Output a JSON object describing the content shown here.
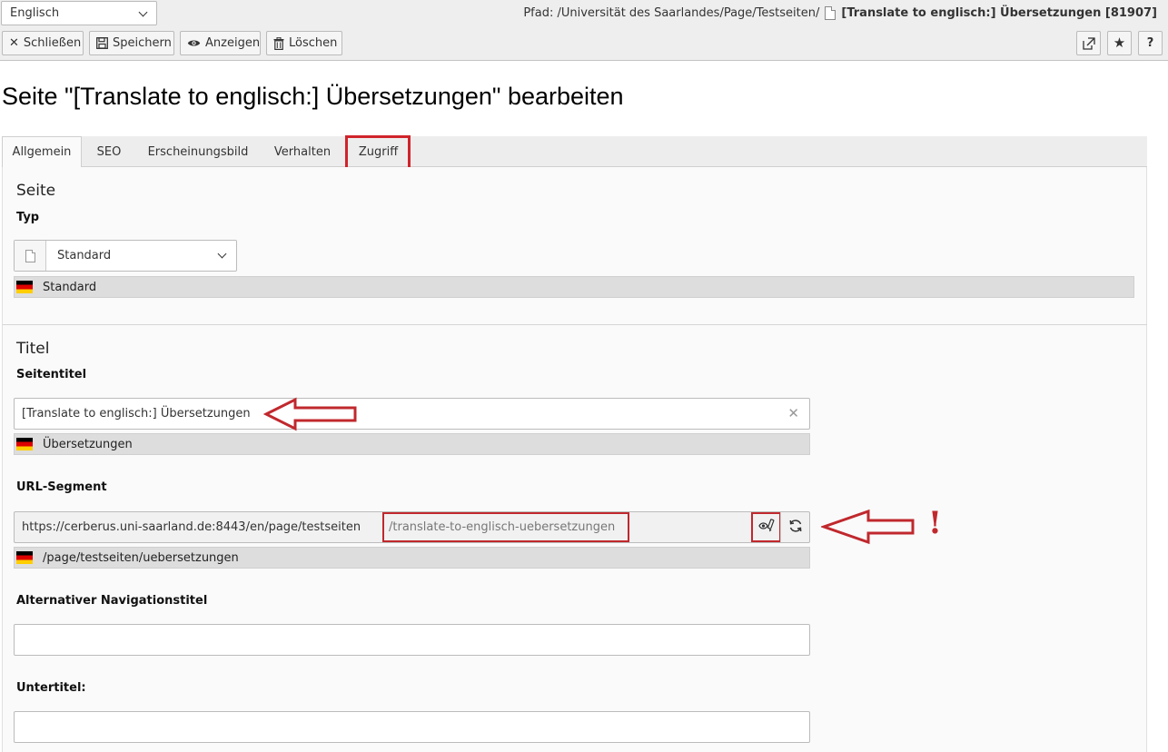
{
  "header": {
    "language_select": "Englisch",
    "path_label": "Pfad: /Universität des Saarlandes/Page/Testseiten/",
    "record_title": "[Translate to englisch:] Übersetzungen [81907]"
  },
  "toolbar": {
    "close_label": "Schließen",
    "save_label": "Speichern",
    "view_label": "Anzeigen",
    "delete_label": "Löschen",
    "help_label": "?"
  },
  "page": {
    "title": "Seite \"[Translate to englisch:] Übersetzungen\" bearbeiten"
  },
  "tabs": [
    {
      "label": "Allgemein",
      "active": true
    },
    {
      "label": "SEO",
      "active": false
    },
    {
      "label": "Erscheinungsbild",
      "active": false
    },
    {
      "label": "Verhalten",
      "active": false
    },
    {
      "label": "Zugriff",
      "active": false,
      "highlighted": true
    }
  ],
  "section_page": {
    "legend": "Seite",
    "type_label": "Typ",
    "type_value": "Standard",
    "type_default": "Standard"
  },
  "section_title": {
    "legend": "Titel",
    "page_title_label": "Seitentitel",
    "page_title_value": "[Translate to englisch:] Übersetzungen",
    "page_title_default": "Übersetzungen",
    "url_label": "URL-Segment",
    "url_prefix": "https://cerberus.uni-saarland.de:8443/en/page/testseiten",
    "url_segment": "/translate-to-englisch-uebersetzungen",
    "url_default": "/page/testseiten/uebersetzungen",
    "nav_title_label": "Alternativer Navigationstitel",
    "nav_title_value": "",
    "subtitle_label": "Untertitel:",
    "subtitle_value": ""
  },
  "annotations": {
    "exclamation": "!",
    "highlight_color": "#c0282d"
  },
  "icons": [
    "close-icon",
    "save-icon",
    "eye-icon",
    "trash-icon",
    "external-link-icon",
    "star-icon",
    "page-icon",
    "de-flag-icon",
    "edit-url-icon",
    "refresh-icon"
  ]
}
